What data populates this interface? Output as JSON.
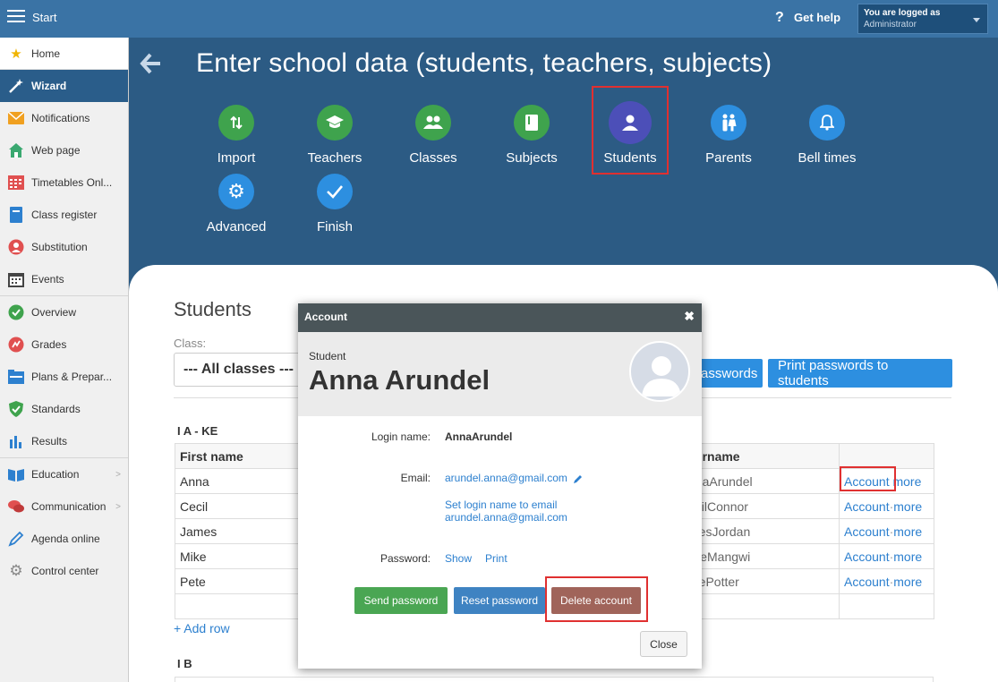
{
  "topbar": {
    "start": "Start",
    "help": "Get help",
    "logged_label": "You are logged as",
    "logged_user": "Administrator"
  },
  "sidebar": {
    "items": [
      {
        "label": "Home"
      },
      {
        "label": "Wizard"
      },
      {
        "label": "Notifications"
      },
      {
        "label": "Web page"
      },
      {
        "label": "Timetables Onl..."
      },
      {
        "label": "Class register"
      },
      {
        "label": "Substitution"
      },
      {
        "label": "Events"
      },
      {
        "label": "Overview"
      },
      {
        "label": "Grades"
      },
      {
        "label": "Plans & Prepar..."
      },
      {
        "label": "Standards"
      },
      {
        "label": "Results"
      },
      {
        "label": "Education"
      },
      {
        "label": "Communication"
      },
      {
        "label": "Agenda online"
      },
      {
        "label": "Control center"
      }
    ]
  },
  "page": {
    "title": "Enter school data (students, teachers, subjects)"
  },
  "wizard_steps": [
    {
      "label": "Import"
    },
    {
      "label": "Teachers"
    },
    {
      "label": "Classes"
    },
    {
      "label": "Subjects"
    },
    {
      "label": "Students"
    },
    {
      "label": "Parents"
    },
    {
      "label": "Bell times"
    },
    {
      "label": "Advanced"
    },
    {
      "label": "Finish"
    }
  ],
  "students": {
    "heading": "Students",
    "class_label": "Class:",
    "class_value": "--- All classes ---",
    "btn_passwords": "asswords",
    "btn_print": "Print passwords to students",
    "group_a": "I A - KE",
    "group_b": "I B",
    "col_first": "First name",
    "col_user": "sername",
    "account_link": "Account",
    "more_link": "more",
    "sep": "·",
    "add_row": "+ Add row",
    "rows": [
      {
        "first": "Anna",
        "user": "nnaArundel"
      },
      {
        "first": "Cecil",
        "user": "ecilConnor"
      },
      {
        "first": "James",
        "user": "mesJordan"
      },
      {
        "first": "Mike",
        "user": "likeMangwi"
      },
      {
        "first": "Pete",
        "user": "etePotter"
      }
    ]
  },
  "modal": {
    "title": "Account",
    "close_x": "✖",
    "role": "Student",
    "name": "Anna Arundel",
    "login_label": "Login name:",
    "login_value": "AnnaArundel",
    "email_label": "Email:",
    "email_value": "arundel.anna@gmail.com",
    "set_login_1": "Set login name to email",
    "set_login_2": "arundel.anna@gmail.com",
    "password_label": "Password:",
    "show": "Show",
    "print": "Print",
    "send_password": "Send password",
    "reset_password": "Reset password",
    "delete_account": "Delete account",
    "close": "Close"
  },
  "colors": {
    "topbar": "#3a73a5",
    "header_bg": "#2c5b84",
    "accent": "#2d8fe0",
    "green": "#3fa34d",
    "delete": "#a0645a",
    "highlight": "#e03030"
  }
}
